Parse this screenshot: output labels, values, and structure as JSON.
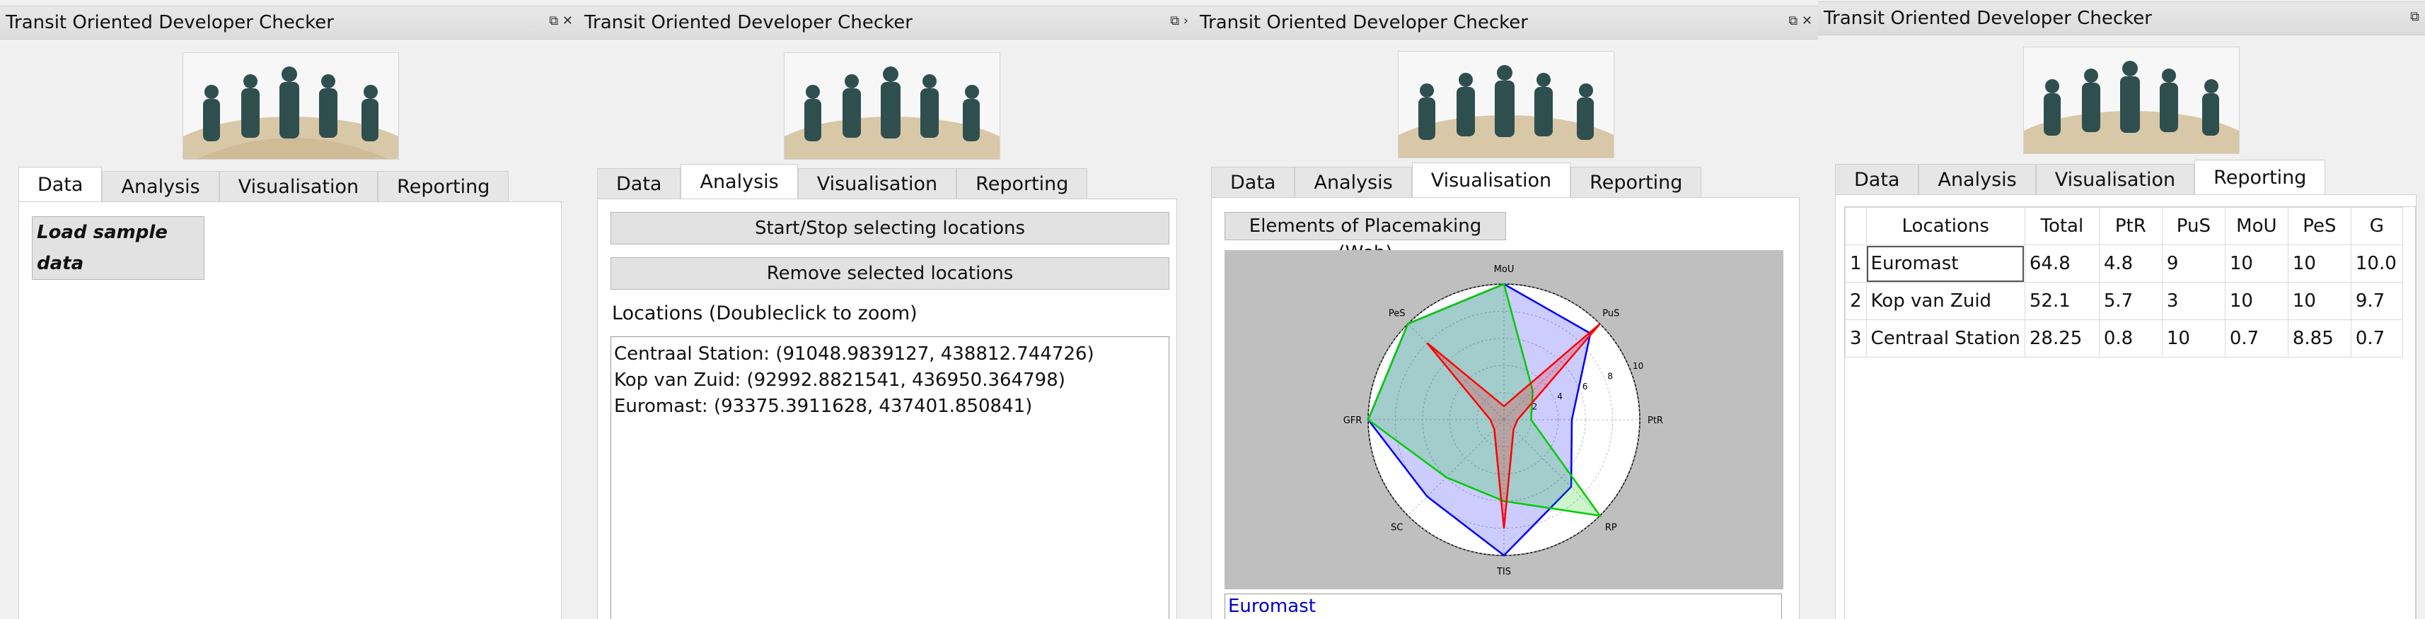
{
  "app": {
    "title": "Transit Oriented Developer Checker",
    "float_icon": "float-icon",
    "close_icon": "close-icon",
    "arrow_icon": "›"
  },
  "tabs": [
    "Data",
    "Analysis",
    "Visualisation",
    "Reporting"
  ],
  "panel1": {
    "active_tab": "Data",
    "load_button": "Load sample data"
  },
  "panel2": {
    "active_tab": "Analysis",
    "select_button": "Start/Stop selecting locations",
    "remove_button": "Remove selected locations",
    "locations_label": "Locations (Doubleclick to zoom)",
    "locations": [
      "Centraal Station: (91048.9839127, 438812.744726)",
      "Kop van Zuid: (92992.8821541, 436950.364798)",
      "Euromast: (93375.3911628, 437401.850841)"
    ]
  },
  "panel3": {
    "active_tab": "Visualisation",
    "chart_title_button": "Elements of Placemaking (Web)",
    "legend_first": "Euromast",
    "colors": {
      "Euromast": "#0000ff",
      "Kop van Zuid": "#00cc00",
      "Centraal Station": "#ff0000"
    }
  },
  "panel4": {
    "active_tab": "Reporting",
    "table": {
      "headers": [
        "Locations",
        "Total",
        "PtR",
        "PuS",
        "MoU",
        "PeS",
        "G"
      ],
      "rows": [
        {
          "index": "1",
          "cells": [
            "Euromast",
            "64.8",
            "4.8",
            "9",
            "10",
            "10",
            "10.0"
          ]
        },
        {
          "index": "2",
          "cells": [
            "Kop van Zuid",
            "52.1",
            "5.7",
            "3",
            "10",
            "10",
            "9.7"
          ]
        },
        {
          "index": "3",
          "cells": [
            "Centraal Station",
            "28.25",
            "0.8",
            "10",
            "0.7",
            "8.85",
            "0.7"
          ]
        }
      ]
    }
  },
  "chart_data": {
    "type": "radar",
    "axes": [
      "MoU",
      "PuS",
      "PtR",
      "RP",
      "TIS",
      "SC",
      "GFR",
      "PeS"
    ],
    "radial_ticks": [
      "2",
      "4",
      "6",
      "8",
      "10"
    ],
    "rlim": [
      0,
      10
    ],
    "series": [
      {
        "name": "Euromast",
        "color": "#0000ff",
        "values": [
          10,
          9,
          5,
          7,
          10,
          8,
          10,
          10
        ]
      },
      {
        "name": "Kop van Zuid",
        "color": "#00cc00",
        "values": [
          10,
          3,
          2,
          10,
          6,
          6,
          10,
          10
        ]
      },
      {
        "name": "Centraal Station",
        "color": "#ff0000",
        "values": [
          1,
          10,
          1,
          1,
          8,
          1,
          1,
          8
        ]
      }
    ]
  }
}
